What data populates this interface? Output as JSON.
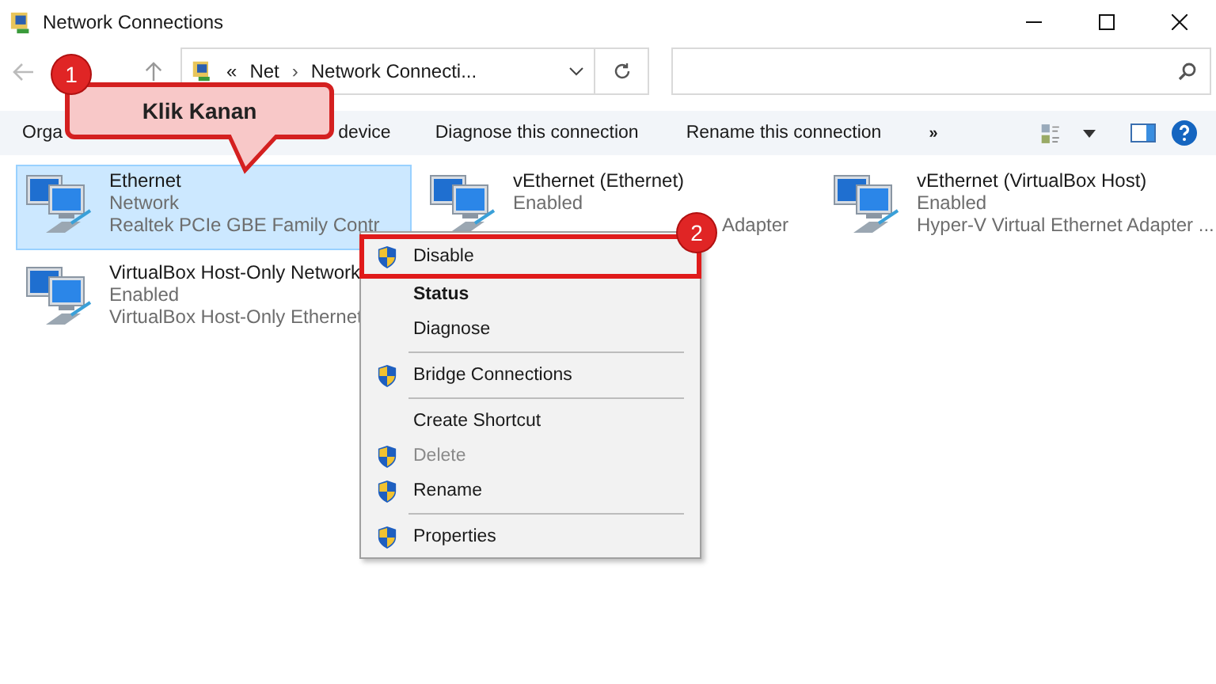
{
  "window": {
    "title": "Network Connections"
  },
  "address": {
    "chevron": "«",
    "crumbs": [
      "Net",
      "Network Connecti..."
    ],
    "separator": "›"
  },
  "toolbar": {
    "items": [
      "Orga",
      "device",
      "Diagnose this connection",
      "Rename this connection",
      "»"
    ]
  },
  "connections": [
    {
      "name": "Ethernet",
      "status": "Network",
      "description": "Realtek PCIe GBE Family Contr",
      "selected": true
    },
    {
      "name": "vEthernet (Ethernet)",
      "status": "Enabled",
      "description": "Adapter",
      "selected": false
    },
    {
      "name": "vEthernet (VirtualBox Host)",
      "status": "Enabled",
      "description": "Hyper-V Virtual Ethernet Adapter ...",
      "selected": false
    },
    {
      "name": "VirtualBox Host-Only Network",
      "status": "Enabled",
      "description": "VirtualBox Host-Only Ethernet",
      "selected": false
    }
  ],
  "context_menu": [
    {
      "kind": "item",
      "label": "Disable",
      "shield": true,
      "bold": false,
      "disabled": false,
      "highlighted": true
    },
    {
      "kind": "item",
      "label": "Status",
      "shield": false,
      "bold": true,
      "disabled": false,
      "highlighted": false
    },
    {
      "kind": "item",
      "label": "Diagnose",
      "shield": false,
      "bold": false,
      "disabled": false,
      "highlighted": false
    },
    {
      "kind": "separator"
    },
    {
      "kind": "item",
      "label": "Bridge Connections",
      "shield": true,
      "bold": false,
      "disabled": false,
      "highlighted": false
    },
    {
      "kind": "separator"
    },
    {
      "kind": "item",
      "label": "Create Shortcut",
      "shield": false,
      "bold": false,
      "disabled": false,
      "highlighted": false
    },
    {
      "kind": "item",
      "label": "Delete",
      "shield": true,
      "bold": false,
      "disabled": true,
      "highlighted": false
    },
    {
      "kind": "item",
      "label": "Rename",
      "shield": true,
      "bold": false,
      "disabled": false,
      "highlighted": false
    },
    {
      "kind": "separator"
    },
    {
      "kind": "item",
      "label": "Properties",
      "shield": true,
      "bold": false,
      "disabled": false,
      "highlighted": false
    }
  ],
  "annotations": {
    "callout": "Klik Kanan",
    "step_badges": [
      "1",
      "2"
    ]
  }
}
